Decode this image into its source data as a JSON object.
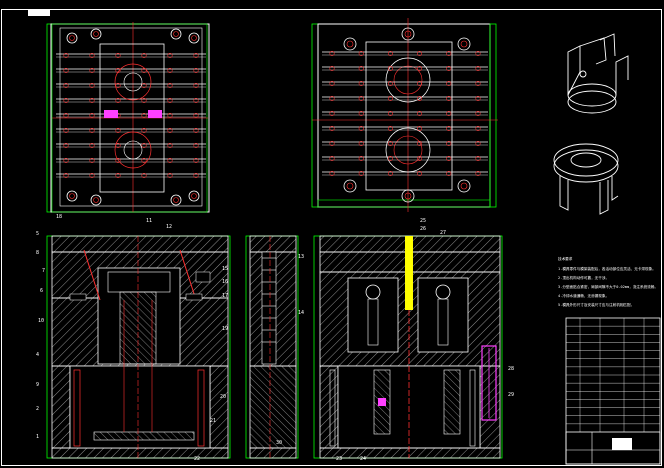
{
  "drawing": {
    "title_tag": "",
    "part_labels": [
      "18",
      "11",
      "12",
      "5",
      "8",
      "7",
      "6",
      "10",
      "4",
      "9",
      "2",
      "1",
      "15",
      "16",
      "17",
      "13",
      "19",
      "14",
      "20",
      "21",
      "22",
      "23",
      "24",
      "25",
      "26",
      "27",
      "28",
      "29",
      "30"
    ],
    "notes_heading": "技术要求",
    "notes": [
      "1.模具零件与模架装配后，各活动部位应灵活、无卡滞现象。",
      "2.顶出机构动作可靠，无干涉。",
      "3.分型面贴合紧密，局部间隙不大于0.02mm，浇注系统流畅。",
      "4.冷却水道通畅，无渗漏现象。",
      "5.模具外形尺寸及安装尺寸应与注射机相匹配。"
    ],
    "title_block_rows": 14
  }
}
